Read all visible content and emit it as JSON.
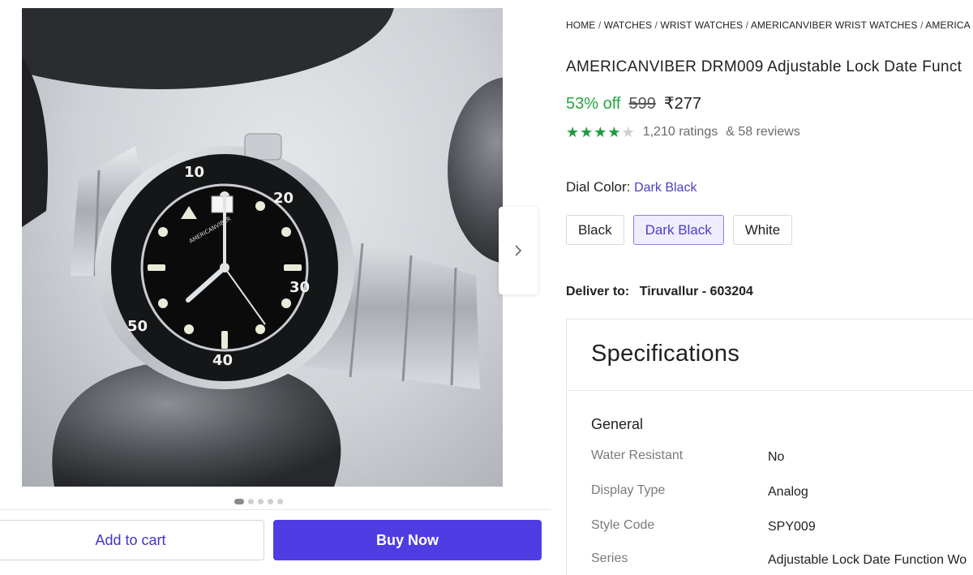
{
  "breadcrumb": [
    "HOME",
    "WATCHES",
    "WRIST WATCHES",
    "AMERICANVIBER WRIST WATCHES",
    "AMERICA"
  ],
  "product": {
    "title": "AMERICANVIBER DRM009 Adjustable Lock Date Funct",
    "brand_on_dial": "AMERICANVIBER"
  },
  "price": {
    "discount": "53% off",
    "mrp": "599",
    "selling": "₹277"
  },
  "rating": {
    "stars": 4,
    "max_stars": 5,
    "ratings_text": "1,210 ratings",
    "reviews_text": "& 58 reviews"
  },
  "dial_color": {
    "label": "Dial Color:",
    "selected": "Dark Black",
    "options": [
      "Black",
      "Dark Black",
      "White"
    ]
  },
  "delivery": {
    "label": "Deliver to:",
    "location": "Tiruvallur - 603204"
  },
  "specifications": {
    "title": "Specifications",
    "group": "General",
    "rows": [
      {
        "key": "Water Resistant",
        "value": "No"
      },
      {
        "key": "Display Type",
        "value": "Analog"
      },
      {
        "key": "Style Code",
        "value": "SPY009"
      },
      {
        "key": "Series",
        "value": "Adjustable Lock Date Function Wo"
      }
    ]
  },
  "gallery": {
    "total_images": 5,
    "active_index": 0,
    "bezel_numbers": [
      "10",
      "20",
      "30",
      "40",
      "50"
    ]
  },
  "actions": {
    "add_to_cart": "Add to cart",
    "buy_now": "Buy Now"
  },
  "colors": {
    "accent": "#4f3de3",
    "discount_green": "#26a541",
    "star_green": "#1c9c3f",
    "link_purple": "#4b3fc1"
  }
}
